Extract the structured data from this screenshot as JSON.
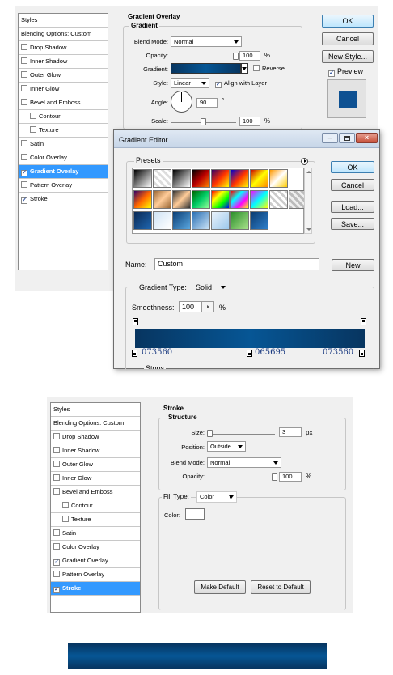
{
  "panel1": {
    "sidebar": {
      "items": [
        {
          "label": "Styles",
          "check": false,
          "selected": false
        },
        {
          "label": "Blending Options: Custom",
          "check": false,
          "selected": false
        },
        {
          "label": "Drop Shadow",
          "check": true,
          "checked": false,
          "selected": false
        },
        {
          "label": "Inner Shadow",
          "check": true,
          "checked": false,
          "selected": false
        },
        {
          "label": "Outer Glow",
          "check": true,
          "checked": false,
          "selected": false
        },
        {
          "label": "Inner Glow",
          "check": true,
          "checked": false,
          "selected": false
        },
        {
          "label": "Bevel and Emboss",
          "check": true,
          "checked": false,
          "selected": false
        },
        {
          "label": "Contour",
          "check": true,
          "checked": false,
          "selected": false,
          "indent": true
        },
        {
          "label": "Texture",
          "check": true,
          "checked": false,
          "selected": false,
          "indent": true
        },
        {
          "label": "Satin",
          "check": true,
          "checked": false,
          "selected": false
        },
        {
          "label": "Color Overlay",
          "check": true,
          "checked": false,
          "selected": false
        },
        {
          "label": "Gradient Overlay",
          "check": true,
          "checked": true,
          "selected": true
        },
        {
          "label": "Pattern Overlay",
          "check": true,
          "checked": false,
          "selected": false
        },
        {
          "label": "Stroke",
          "check": true,
          "checked": true,
          "selected": false
        }
      ]
    },
    "section_title": "Gradient Overlay",
    "group_title": "Gradient",
    "blend_mode_label": "Blend Mode:",
    "blend_mode_value": "Normal",
    "opacity_label": "Opacity:",
    "opacity_value": "100",
    "opacity_unit": "%",
    "opacity_level": 1.0,
    "gradient_label": "Gradient:",
    "reverse_label": "Reverse",
    "reverse_checked": false,
    "style_label": "Style:",
    "style_value": "Linear",
    "align_label": "Align with Layer",
    "align_checked": true,
    "angle_label": "Angle:",
    "angle_value": "90",
    "angle_unit": "°",
    "scale_label": "Scale:",
    "scale_value": "100",
    "scale_unit": "%",
    "scale_level": 0.5,
    "ok_label": "OK",
    "cancel_label": "Cancel",
    "new_style_label": "New Style...",
    "preview_label": "Preview",
    "preview_checked": true
  },
  "gradient_editor": {
    "title": "Gradient Editor",
    "presets_label": "Presets",
    "ok_label": "OK",
    "cancel_label": "Cancel",
    "load_label": "Load...",
    "save_label": "Save...",
    "name_label": "Name:",
    "name_value": "Custom",
    "new_label": "New",
    "gradient_type_label": "Gradient Type:",
    "gradient_type_value": "Solid",
    "smoothness_label": "Smoothness:",
    "smoothness_value": "100",
    "smoothness_unit": "%",
    "stops_label": "Stops",
    "color_stops": [
      {
        "hex": "073560",
        "pos": 0.0
      },
      {
        "hex": "065695",
        "pos": 0.5
      },
      {
        "hex": "073560",
        "pos": 1.0
      }
    ]
  },
  "panel2": {
    "sidebar": {
      "items": [
        {
          "label": "Styles",
          "check": false,
          "selected": false
        },
        {
          "label": "Blending Options: Custom",
          "check": false,
          "selected": false
        },
        {
          "label": "Drop Shadow",
          "check": true,
          "checked": false,
          "selected": false
        },
        {
          "label": "Inner Shadow",
          "check": true,
          "checked": false,
          "selected": false
        },
        {
          "label": "Outer Glow",
          "check": true,
          "checked": false,
          "selected": false
        },
        {
          "label": "Inner Glow",
          "check": true,
          "checked": false,
          "selected": false
        },
        {
          "label": "Bevel and Emboss",
          "check": true,
          "checked": false,
          "selected": false
        },
        {
          "label": "Contour",
          "check": true,
          "checked": false,
          "selected": false,
          "indent": true
        },
        {
          "label": "Texture",
          "check": true,
          "checked": false,
          "selected": false,
          "indent": true
        },
        {
          "label": "Satin",
          "check": true,
          "checked": false,
          "selected": false
        },
        {
          "label": "Color Overlay",
          "check": true,
          "checked": false,
          "selected": false
        },
        {
          "label": "Gradient Overlay",
          "check": true,
          "checked": true,
          "selected": false
        },
        {
          "label": "Pattern Overlay",
          "check": true,
          "checked": false,
          "selected": false
        },
        {
          "label": "Stroke",
          "check": true,
          "checked": true,
          "selected": true
        }
      ]
    },
    "section_title": "Stroke",
    "group_title": "Structure",
    "size_label": "Size:",
    "size_value": "3",
    "size_unit": "px",
    "size_level": 0.02,
    "position_label": "Position:",
    "position_value": "Outside",
    "blend_mode_label": "Blend Mode:",
    "blend_mode_value": "Normal",
    "opacity_label": "Opacity:",
    "opacity_value": "100",
    "opacity_unit": "%",
    "opacity_level": 1.0,
    "fill_type_label": "Fill Type:",
    "fill_type_value": "Color",
    "color_label": "Color:",
    "stroke_color": "#ffffff",
    "make_default_label": "Make Default",
    "reset_default_label": "Reset to Default"
  },
  "colors": {
    "accent": "#3399ff",
    "gradient_dark": "#073560",
    "gradient_mid": "#065695",
    "preview_swatch": "#0e5192"
  }
}
